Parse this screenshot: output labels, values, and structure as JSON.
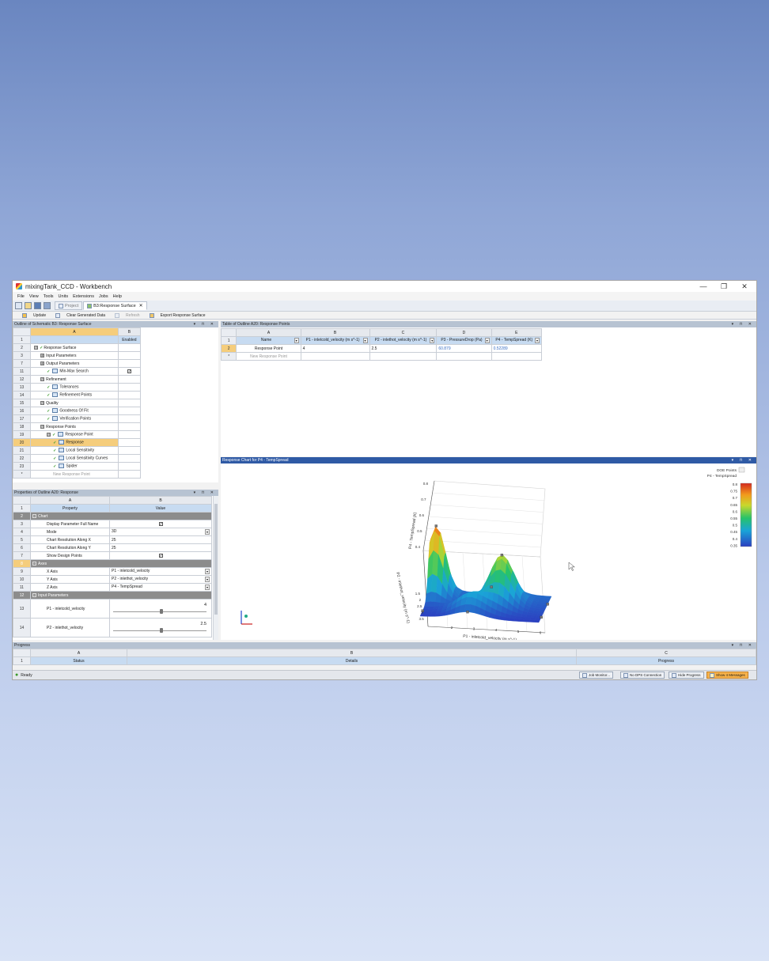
{
  "window": {
    "title": "mixingTank_CCD - Workbench",
    "controls": {
      "minimize": "—",
      "restore": "❐",
      "close": "✕"
    }
  },
  "menu": [
    "File",
    "View",
    "Tools",
    "Units",
    "Extensions",
    "Jobs",
    "Help"
  ],
  "tabs": [
    {
      "label": "Project",
      "active": false
    },
    {
      "label": "B3:Response Surface",
      "active": true
    }
  ],
  "tab_close": "✕",
  "toolbar": {
    "update": "Update",
    "clear": "Clear Generated Data",
    "refresh": "Refresh",
    "export": "Export Response Surface"
  },
  "outline": {
    "title": "Outline of Schematic B3: Response Surface",
    "col_a": "A",
    "col_b": "B",
    "enabled_header": "Enabled",
    "rows": [
      {
        "n": "1",
        "label": "",
        "indent": 0,
        "exp": "",
        "chk": false,
        "icon": false,
        "enabled": false
      },
      {
        "n": "2",
        "label": "Response Surface",
        "indent": 0,
        "exp": "⊟",
        "chk": true,
        "icon": false,
        "enabled": false
      },
      {
        "n": "3",
        "label": "Input Parameters",
        "indent": 1,
        "exp": "⊞",
        "chk": false,
        "icon": false,
        "enabled": false
      },
      {
        "n": "7",
        "label": "Output Parameters",
        "indent": 1,
        "exp": "⊞",
        "chk": false,
        "icon": false,
        "enabled": false
      },
      {
        "n": "11",
        "label": "Min-Max Search",
        "indent": 2,
        "exp": "",
        "chk": true,
        "icon": true,
        "enabled": true
      },
      {
        "n": "12",
        "label": "Refinement",
        "indent": 1,
        "exp": "⊟",
        "chk": false,
        "icon": false,
        "enabled": false
      },
      {
        "n": "13",
        "label": "Tolerances",
        "indent": 2,
        "exp": "",
        "chk": true,
        "icon": true,
        "enabled": false
      },
      {
        "n": "14",
        "label": "Refinement Points",
        "indent": 2,
        "exp": "",
        "chk": true,
        "icon": true,
        "enabled": false
      },
      {
        "n": "15",
        "label": "Quality",
        "indent": 1,
        "exp": "⊟",
        "chk": false,
        "icon": false,
        "enabled": false
      },
      {
        "n": "16",
        "label": "Goodness Of Fit",
        "indent": 2,
        "exp": "",
        "chk": true,
        "icon": true,
        "enabled": false
      },
      {
        "n": "17",
        "label": "Verification Points",
        "indent": 2,
        "exp": "",
        "chk": true,
        "icon": true,
        "enabled": false
      },
      {
        "n": "18",
        "label": "Response Points",
        "indent": 1,
        "exp": "⊟",
        "chk": false,
        "icon": false,
        "enabled": false
      },
      {
        "n": "19",
        "label": "Response Point",
        "indent": 2,
        "exp": "⊟",
        "chk": true,
        "icon": true,
        "enabled": false
      },
      {
        "n": "20",
        "label": "Response",
        "indent": 3,
        "exp": "",
        "chk": true,
        "icon": true,
        "enabled": false,
        "selected": true
      },
      {
        "n": "21",
        "label": "Local Sensitivity",
        "indent": 3,
        "exp": "",
        "chk": true,
        "icon": true,
        "enabled": false
      },
      {
        "n": "22",
        "label": "Local Sensitivity Curves",
        "indent": 3,
        "exp": "",
        "chk": true,
        "icon": true,
        "enabled": false
      },
      {
        "n": "23",
        "label": "Spider",
        "indent": 3,
        "exp": "",
        "chk": true,
        "icon": true,
        "enabled": false
      },
      {
        "n": "*",
        "label": "New Response Point",
        "indent": 3,
        "exp": "",
        "chk": false,
        "icon": false,
        "enabled": false,
        "placeholder": true
      }
    ]
  },
  "properties": {
    "title": "Properties of Outline A20: Response",
    "col_a": "A",
    "col_b": "B",
    "header_property": "Property",
    "header_value": "Value",
    "rows": [
      {
        "n": "1",
        "type": "header"
      },
      {
        "n": "2",
        "type": "section",
        "label": "Chart"
      },
      {
        "n": "3",
        "type": "prop",
        "label": "Display Parameter Full Name",
        "value": "",
        "check": true
      },
      {
        "n": "4",
        "type": "prop",
        "label": "Mode",
        "value": "3D",
        "dropdown": true
      },
      {
        "n": "5",
        "type": "prop",
        "label": "Chart Resolution Along X",
        "value": "25"
      },
      {
        "n": "6",
        "type": "prop",
        "label": "Chart Resolution Along Y",
        "value": "25"
      },
      {
        "n": "7",
        "type": "prop",
        "label": "Show Design Points",
        "value": "",
        "check": true
      },
      {
        "n": "8",
        "type": "section",
        "label": "Axes",
        "selected": true
      },
      {
        "n": "9",
        "type": "prop",
        "label": "X Axis",
        "value": "P1 - inletcold_velocity",
        "dropdown": true
      },
      {
        "n": "10",
        "type": "prop",
        "label": "Y Axis",
        "value": "P2 - inlethot_velocity",
        "dropdown": true
      },
      {
        "n": "11",
        "type": "prop",
        "label": "Z Axis",
        "value": "P4 - TempSpread",
        "dropdown": true
      },
      {
        "n": "12",
        "type": "section",
        "label": "Input Parameters"
      },
      {
        "n": "13",
        "type": "slider",
        "label": "P1 - inletcold_velocity",
        "value": "4",
        "fraction": 0.5
      },
      {
        "n": "14",
        "type": "slider",
        "label": "P2 - inlethot_velocity",
        "value": "2.5",
        "fraction": 0.5
      }
    ]
  },
  "response_table": {
    "title": "Table of Outline A20: Response Points",
    "cols": [
      "A",
      "B",
      "C",
      "D",
      "E"
    ],
    "headers": [
      "Name",
      "P1 - inletcold_velocity (m s^-1)",
      "P2 - inlethot_velocity (m s^-1)",
      "P3 - PressureDrop (Pa)",
      "P4 - TempSpread (K)"
    ],
    "rows": [
      {
        "n": "2",
        "cells": [
          "Response Point",
          "4",
          "2.5",
          "60.879",
          "0.52289"
        ]
      },
      {
        "n": "*",
        "cells": [
          "New Response Point",
          "",
          "",
          "",
          ""
        ]
      }
    ]
  },
  "chart": {
    "title": "Response Chart for P4 - TempSpread",
    "legend_title": "P4 - TempSpread",
    "doe_label": "DOE Points",
    "colorbar": [
      "0.8",
      "0.75",
      "0.7",
      "0.65",
      "0.6",
      "0.55",
      "0.5",
      "0.45",
      "0.4",
      "0.35"
    ]
  },
  "chart_data": {
    "type": "surface",
    "zlabel": "P4 - TempSpread (K)",
    "xlabel": "P1 - inletcold_velocity (m s^-1)",
    "ylabel": "P2 - inlethot_velocity (m s^-1)",
    "x_ticks": [
      "2",
      "3",
      "4",
      "5",
      "6"
    ],
    "y_ticks": [
      "1.5",
      "2",
      "2.5",
      "3",
      "3.5"
    ],
    "z_ticks": [
      "0.8",
      "0.7",
      "0.6",
      "0.5",
      "0.4"
    ],
    "colorscale": {
      "min": 0.35,
      "max": 0.8,
      "ticks": [
        0.8,
        0.75,
        0.7,
        0.65,
        0.6,
        0.55,
        0.5,
        0.45,
        0.4,
        0.35
      ]
    }
  },
  "progress": {
    "title": "Progress",
    "cols": [
      "A",
      "B",
      "C"
    ],
    "headers": [
      "Status",
      "Details",
      "Progress"
    ],
    "row_n": "1"
  },
  "status": {
    "ready": "Ready",
    "job_monitor": "Job Monitor...",
    "dps": "No DPS Connection",
    "hide_progress": "Hide Progress",
    "messages": "Show 4 Messages"
  },
  "colors": {
    "accent": "#c7dbf1",
    "selection": "#f5cd7c",
    "section": "#8c8c8c",
    "warning": "#f7b24a"
  }
}
